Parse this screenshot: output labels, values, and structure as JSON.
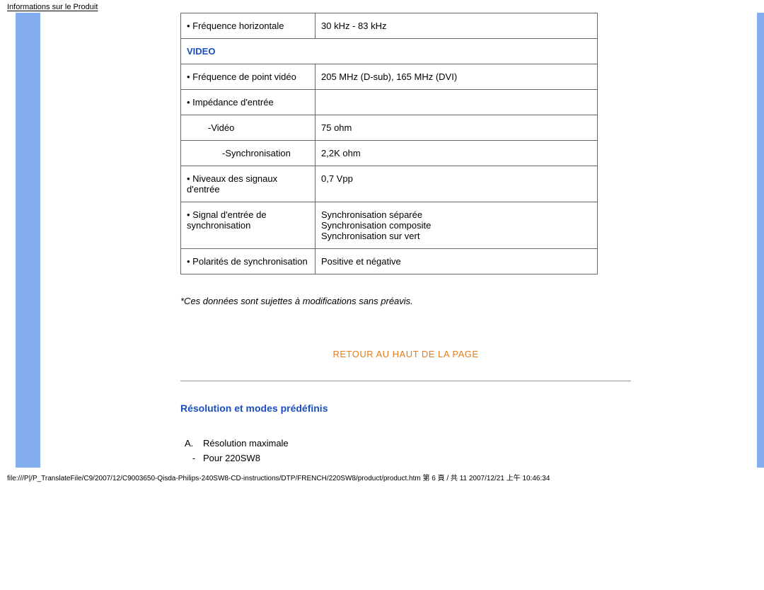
{
  "header": "Informations sur le Produit",
  "specs": {
    "row_freq_h": {
      "label": "• Fréquence horizontale",
      "value": "30 kHz - 83 kHz"
    },
    "section_video": "VIDEO",
    "row_freq_pv": {
      "label": "• Fréquence de point vidéo",
      "value": "205 MHz (D-sub), 165 MHz (DVI)"
    },
    "row_imp": {
      "label": "• Impédance d'entrée",
      "value": ""
    },
    "row_video": {
      "label": "-Vidéo",
      "value": "75 ohm"
    },
    "row_sync": {
      "label": "-Synchronisation",
      "value": "2,2K ohm"
    },
    "row_niv": {
      "label": "• Niveaux des signaux d'entrée",
      "value": "0,7 Vpp"
    },
    "row_sig": {
      "label": "• Signal d'entrée de synchronisation",
      "value": "Synchronisation séparée\nSynchronisation composite\nSynchronisation sur vert"
    },
    "row_pol": {
      "label": "• Polarités de synchronisation",
      "value": "Positive et négative"
    }
  },
  "disclaimer": "*Ces données sont sujettes à modifications sans préavis.",
  "top_link": "RETOUR AU HAUT DE LA PAGE",
  "section_res": "Résolution et modes prédéfinis",
  "res_list": {
    "a_label": "A.",
    "a_text": "Résolution maximale",
    "dash": "-",
    "dash_text": "Pour 220SW8"
  },
  "footer": "file:///P|/P_TranslateFile/C9/2007/12/C9003650-Qisda-Philips-240SW8-CD-instructions/DTP/FRENCH/220SW8/product/product.htm 第 6 頁 / 共 11 2007/12/21 上午 10:46:34"
}
